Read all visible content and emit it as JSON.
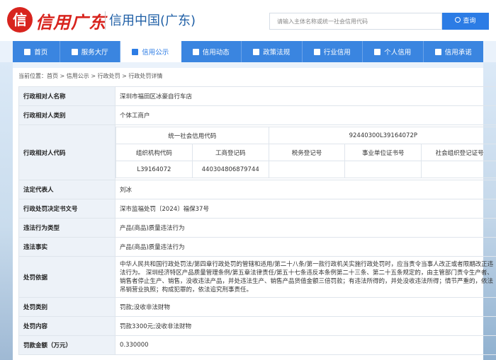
{
  "header": {
    "logo_emblem": "信",
    "logo_script": "信用广东",
    "logo_title": "信用中国(广东)",
    "search": {
      "placeholder": "请输入主体名称或统一社会信用代码",
      "button_label": "查询"
    }
  },
  "nav": {
    "items": [
      {
        "label": "首页",
        "icon": "home-icon"
      },
      {
        "label": "服务大厅",
        "icon": "grid-icon"
      },
      {
        "label": "信用公示",
        "icon": "doc-icon",
        "active": true
      },
      {
        "label": "信用动态",
        "icon": "news-icon"
      },
      {
        "label": "政策法规",
        "icon": "law-icon"
      },
      {
        "label": "行业信用",
        "icon": "chart-icon"
      },
      {
        "label": "个人信用",
        "icon": "user-icon"
      },
      {
        "label": "信用承诺",
        "icon": "promise-icon"
      }
    ]
  },
  "breadcrumb": {
    "prefix": "当前位置：",
    "path": "首页 > 信用公示 > 行政处罚 > 行政处罚详情"
  },
  "detail": {
    "name_label": "行政相对人名称",
    "name_value": "深圳市福田区冰豪自行车店",
    "type_label": "行政相对人类别",
    "type_value": "个体工商户",
    "code_label": "行政相对人代码",
    "uscc_header": "统一社会信用代码",
    "uscc_value": "92440300L39164072P",
    "sub_headers": [
      "组织机构代码",
      "工商登记码",
      "税务登记号",
      "事业单位证书号",
      "社会组织登记证号"
    ],
    "sub_values": [
      "L39164072",
      "440304806879744",
      "",
      "",
      ""
    ],
    "rep_label": "法定代表人",
    "rep_value": "刘冰",
    "decision_label": "行政处罚决定书文号",
    "decision_value": "深市监福处罚〔2024〕福保37号",
    "violation_type_label": "违法行为类型",
    "violation_type_value": "产品(商品)质量违法行为",
    "violation_fact_label": "违法事实",
    "violation_fact_value": "产品(商品)质量违法行为",
    "basis_label": "处罚依据",
    "basis_value": "中华人民共和国行政处罚法/第四章行政处罚的管辖和适用/第二十八条/第一款行政机关实施行政处罚时，应当责令当事人改正或者限期改正违法行为。 深圳经济特区产品质量管理条例/第五章法律责任/第五十七条违反本条例第二十三条、第二十五条规定的，由主管部门责令生产者、销售者停止生产、销售，没收违法产品，并处违法生产、销售产品货值金额三倍罚款；有违法所得的，并处没收违法所得；情节严重的，依法吊销营业执照；构成犯罪的，依法追究刑事责任。",
    "category_label": "处罚类别",
    "category_value": "罚款;没收非法财物",
    "content_label": "处罚内容",
    "content_value": "罚款3300元;没收非法财物",
    "amount_label": "罚款金额（万元）",
    "amount_value": "0.330000"
  }
}
